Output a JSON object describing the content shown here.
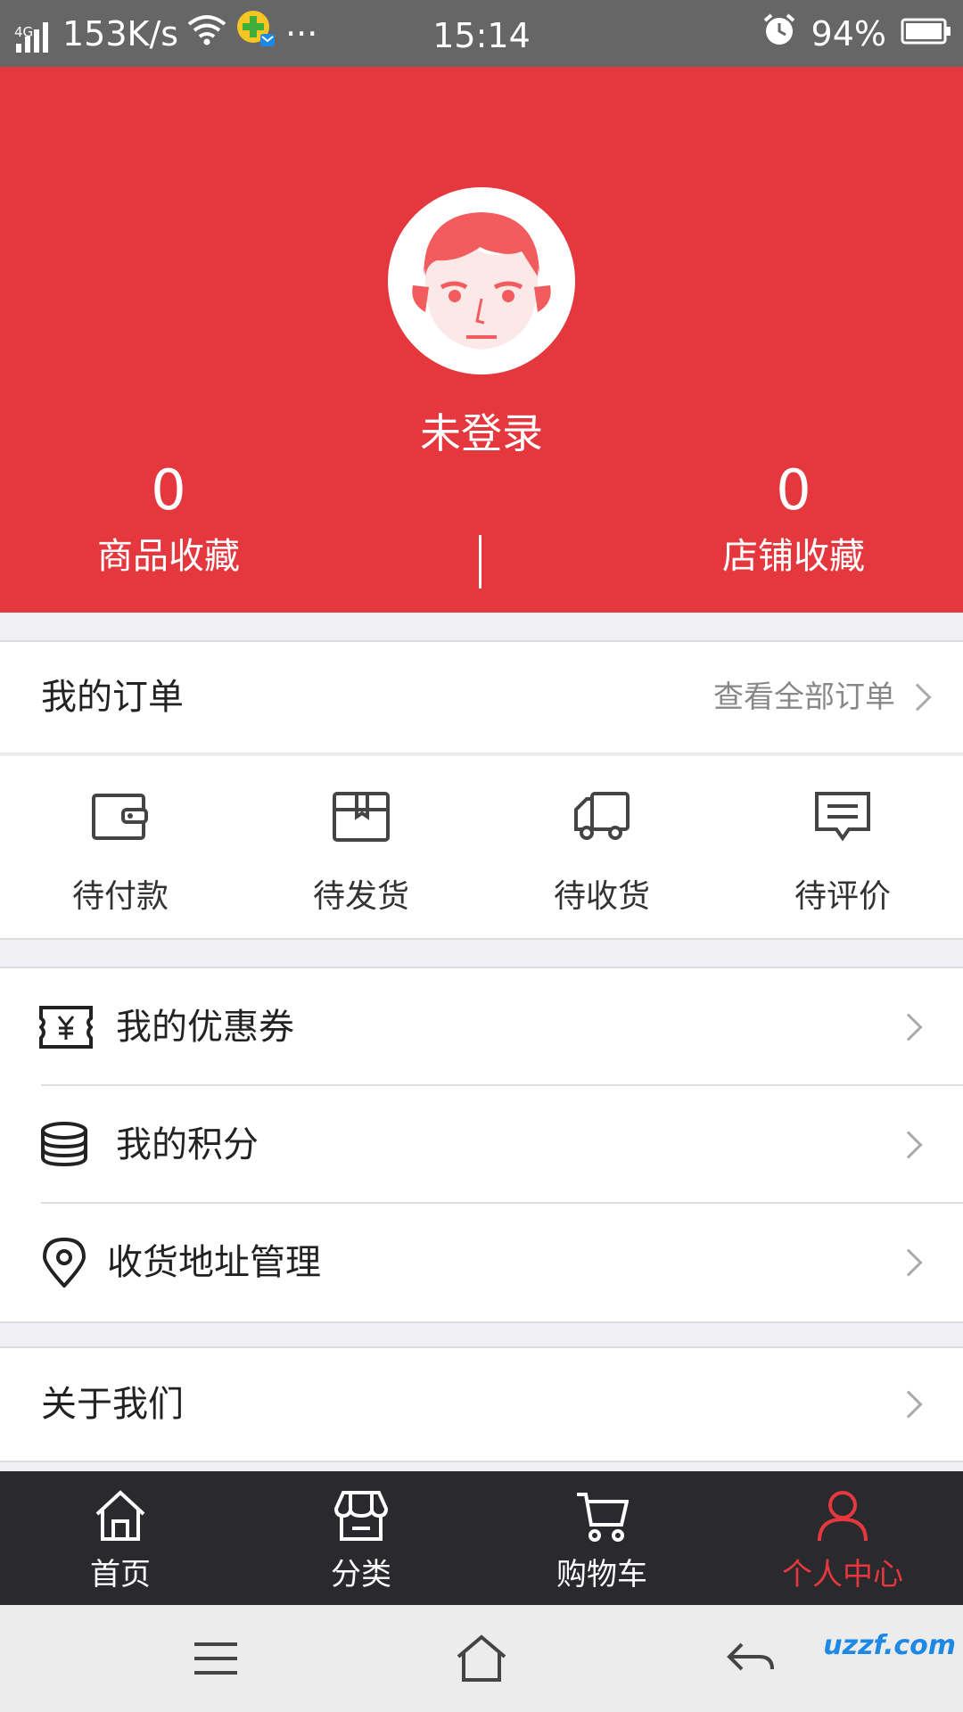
{
  "status_bar": {
    "network_type": "4G",
    "speed": "153K/s",
    "more": "···",
    "time": "15:14",
    "battery": "94%"
  },
  "profile": {
    "login_status": "未登录",
    "stats": [
      {
        "count": "0",
        "label": "商品收藏"
      },
      {
        "count": "0",
        "label": "店铺收藏"
      }
    ]
  },
  "orders": {
    "title": "我的订单",
    "view_all": "查看全部订单",
    "items": [
      {
        "label": "待付款",
        "icon": "wallet-icon"
      },
      {
        "label": "待发货",
        "icon": "package-icon"
      },
      {
        "label": "待收货",
        "icon": "truck-icon"
      },
      {
        "label": "待评价",
        "icon": "comment-icon"
      }
    ]
  },
  "menu": {
    "items": [
      {
        "label": "我的优惠券",
        "icon": "coupon-icon"
      },
      {
        "label": "我的积分",
        "icon": "coins-icon"
      },
      {
        "label": "收货地址管理",
        "icon": "location-pin-icon"
      }
    ],
    "about": "关于我们"
  },
  "tab_bar": {
    "tabs": [
      {
        "label": "首页",
        "icon": "home-icon"
      },
      {
        "label": "分类",
        "icon": "store-icon"
      },
      {
        "label": "购物车",
        "icon": "cart-icon"
      },
      {
        "label": "个人中心",
        "icon": "person-icon"
      }
    ],
    "active_index": 3
  },
  "watermark": "uzzf.com",
  "colors": {
    "brand_red": "#e4373e",
    "tab_bar_bg": "#2a2a2e",
    "status_bar_bg": "#666666"
  }
}
